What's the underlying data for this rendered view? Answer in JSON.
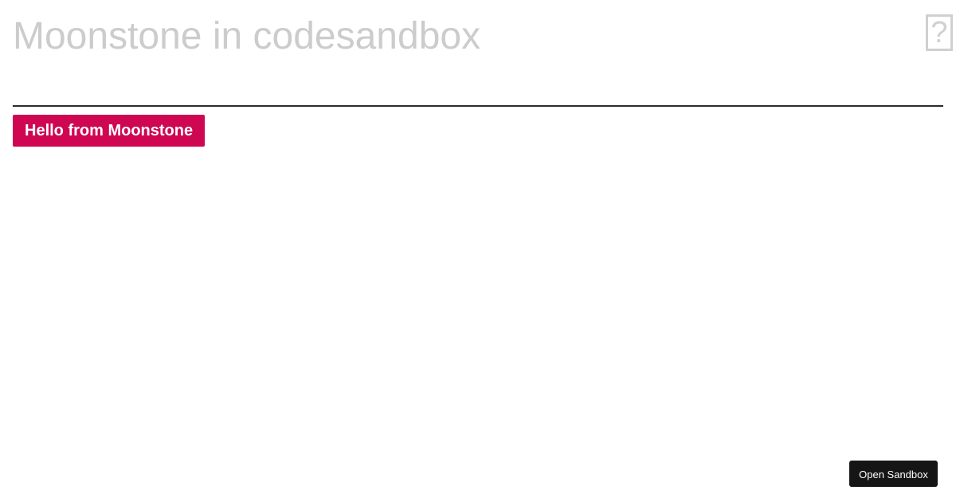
{
  "header": {
    "title": "Moonstone in codesandbox",
    "help_icon": "question-mark-icon",
    "help_glyph": "?"
  },
  "main": {
    "hello_button_label": "Hello from Moonstone"
  },
  "footer": {
    "open_sandbox_label": "Open Sandbox"
  },
  "colors": {
    "title_text": "#cccccc",
    "divider": "#2b2b2b",
    "accent_button": "#cf0652",
    "sandbox_button": "#151515"
  }
}
